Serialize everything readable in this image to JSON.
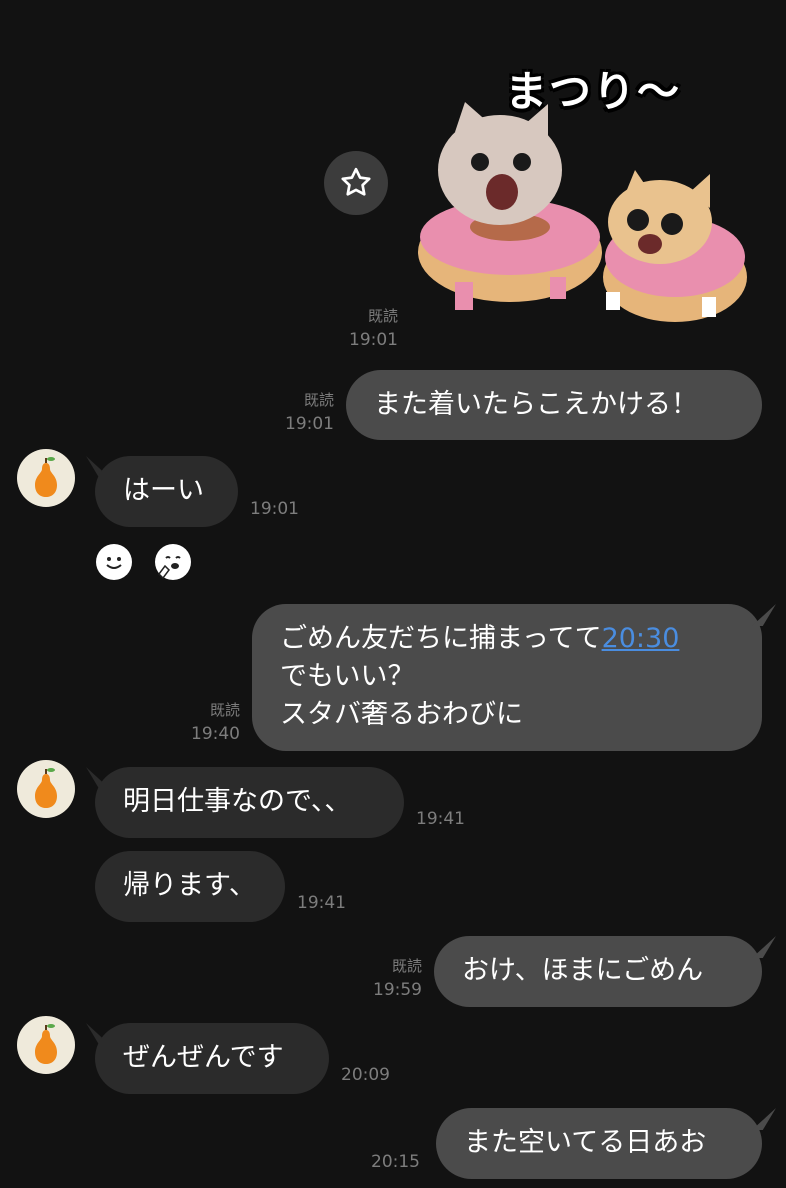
{
  "sticker": {
    "caption": "まつり〜",
    "icon": "cats-in-donuts-sticker"
  },
  "star_button": {
    "icon": "star-icon"
  },
  "messages": [
    {
      "id": "m1",
      "dir": "out",
      "kind": "sticker",
      "read": "既読",
      "time": "19:01"
    },
    {
      "id": "m2",
      "dir": "out",
      "text": "また着いたらこえかける！",
      "read": "既読",
      "time": "19:01"
    },
    {
      "id": "m3",
      "dir": "in",
      "text": "はーい",
      "time": "19:01"
    },
    {
      "id": "m4",
      "dir": "out",
      "text_before": "ごめん友だちに捕まってて",
      "link": "20:30",
      "line2": "でもいい？",
      "line3": "スタバ奢るおわびに",
      "read": "既読",
      "time": "19:40"
    },
    {
      "id": "m5",
      "dir": "in",
      "text": "明日仕事なので、、",
      "time": "19:41"
    },
    {
      "id": "m6",
      "dir": "in",
      "text": "帰ります、",
      "time": "19:41"
    },
    {
      "id": "m7",
      "dir": "out",
      "text": "おけ、ほまにごめん",
      "read": "既読",
      "time": "19:59"
    },
    {
      "id": "m8",
      "dir": "in",
      "text": "ぜんぜんです",
      "time": "20:09"
    },
    {
      "id": "m9",
      "dir": "out",
      "text": "また空いてる日あお",
      "time": "20:15"
    }
  ],
  "reactions": [
    {
      "icon": "smile-reaction-icon"
    },
    {
      "icon": "thinking-face-reaction-icon"
    }
  ],
  "avatar": {
    "icon": "pear-avatar-icon",
    "bg": "#efeadb",
    "fruit_color": "#f08a1c"
  },
  "colors": {
    "background": "#121212",
    "bubble_out": "#4b4b4b",
    "bubble_in": "#2b2b2b",
    "meta": "#7d7d7d",
    "link": "#4a8de0"
  }
}
